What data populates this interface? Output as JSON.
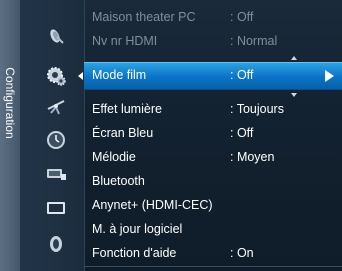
{
  "side_tab": {
    "label": "Configuration"
  },
  "categories": [
    {
      "icon": "satellite-dish-icon"
    },
    {
      "icon": "gear-icon",
      "active": true
    },
    {
      "icon": "antenna-icon"
    },
    {
      "icon": "clock-icon"
    },
    {
      "icon": "input-source-icon"
    },
    {
      "icon": "screen-icon"
    },
    {
      "icon": "support-icon"
    }
  ],
  "menu": {
    "items": [
      {
        "label": "Maison theater PC",
        "value": ": Off",
        "state": "dim"
      },
      {
        "label": "Nv nr HDMI",
        "value": ": Normal",
        "state": "dim"
      },
      {
        "label": "Mode film",
        "value": ": Off",
        "state": "selected"
      },
      {
        "label": "Effet lumière",
        "value": ": Toujours",
        "state": "normal"
      },
      {
        "label": "Écran Bleu",
        "value": ": Off",
        "state": "normal"
      },
      {
        "label": "Mélodie",
        "value": ": Moyen",
        "state": "normal"
      },
      {
        "label": "Bluetooth",
        "value": "",
        "state": "normal"
      },
      {
        "label": "Anynet+ (HDMI-CEC)",
        "value": "",
        "state": "normal"
      },
      {
        "label": "M. à jour logiciel",
        "value": "",
        "state": "normal"
      },
      {
        "label": "Fonction d'aide",
        "value": ": On",
        "state": "normal"
      }
    ]
  },
  "colors": {
    "highlight": "#0a73c6",
    "background": "#132231",
    "dim_text": "#7f8e9b"
  }
}
